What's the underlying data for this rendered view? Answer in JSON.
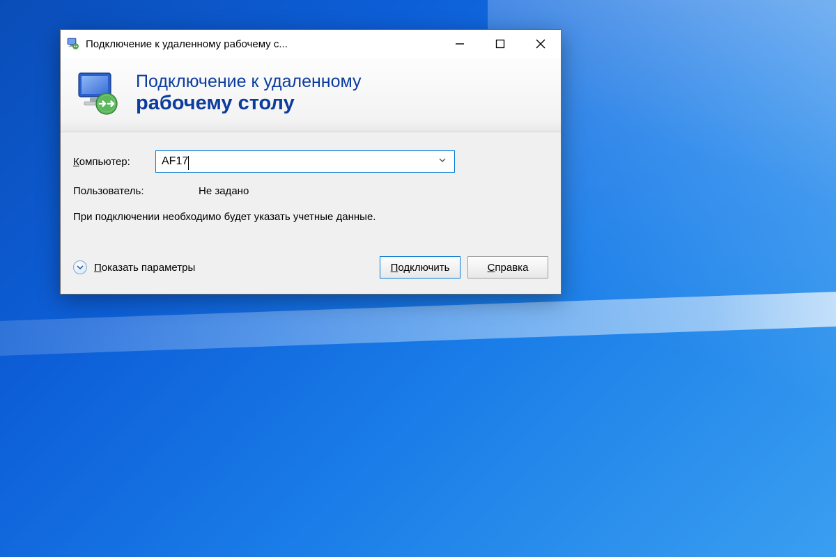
{
  "titlebar": {
    "title": "Подключение к удаленному рабочему с..."
  },
  "banner": {
    "line1": "Подключение к удаленному",
    "line2": "рабочему столу"
  },
  "form": {
    "computer_label": "Компьютер:",
    "computer_value": "AF17",
    "user_label": "Пользователь:",
    "user_value": "Не задано",
    "info_text": "При подключении необходимо будет указать учетные данные."
  },
  "footer": {
    "show_options": "Показать параметры",
    "connect": "Подключить",
    "help": "Справка"
  }
}
